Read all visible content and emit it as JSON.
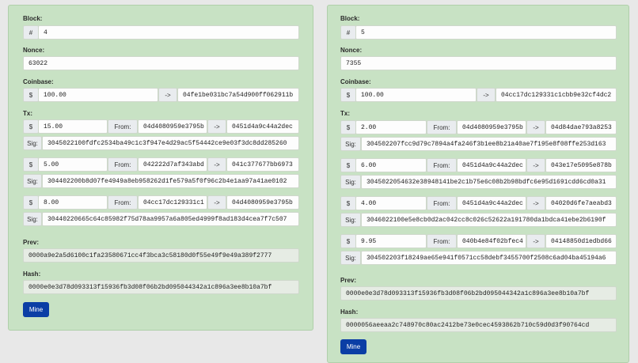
{
  "labels": {
    "block": "Block:",
    "nonce": "Nonce:",
    "coinbase": "Coinbase:",
    "tx": "Tx:",
    "prev": "Prev:",
    "hash": "Hash:",
    "hash_symbol": "#",
    "currency": "$",
    "arrow": "->",
    "from": "From:",
    "sig": "Sig:",
    "mine_button": "Mine"
  },
  "colors": {
    "card_background": "#c8e2c4",
    "mine_button": "#0b3ea5"
  },
  "blocks": [
    {
      "block_number": "4",
      "nonce": "63022",
      "coinbase": {
        "amount": "100.00",
        "to": "04fe1be031bc7a54d900ff062911b"
      },
      "txs": [
        {
          "amount": "15.00",
          "from": "04d4080959e3795b",
          "to": "0451d4a9c44a2dec",
          "sig": "3045022100fdfc2534ba49c1c3f947e4d29ac5f54442ce9e03f3dc8dd285260"
        },
        {
          "amount": "5.00",
          "from": "042222d7af343abd",
          "to": "041c377677bb6973",
          "sig": "304402200b8d07fe4949a8eb958262d1fe579a5f0f96c2b4e1aa97a41ae0102"
        },
        {
          "amount": "8.00",
          "from": "04cc17dc129331c1",
          "to": "04d4080959e3795b",
          "sig": "30440220665c64c85982f75d78aa9957a6a805ed4999f8ad183d4cea7f7c507"
        }
      ],
      "prev": "0000a9e2a5d6100c1fa23580671cc4f3bca3c58180d0f55e49f9e49a389f2777",
      "hash": "0000e0e3d78d093313f15936fb3d08f06b2bd095044342a1c896a3ee8b10a7bf"
    },
    {
      "block_number": "5",
      "nonce": "7355",
      "coinbase": {
        "amount": "100.00",
        "to": "04cc17dc129331c1cbb9e32cf4dc2"
      },
      "txs": [
        {
          "amount": "2.00",
          "from": "04d4080959e3795b",
          "to": "04d84dae793a8253",
          "sig": "304502207fcc9d79c7894a4fa246f3b1ee8b21a40ae7f195e8f08ffe253d163"
        },
        {
          "amount": "6.00",
          "from": "0451d4a9c44a2dec",
          "to": "043e17e5095e878b",
          "sig": "3045022054632e38948141be2c1b75e6c08b2b98bdfc6e95d1691cdd6cd0a31"
        },
        {
          "amount": "4.00",
          "from": "0451d4a9c44a2dec",
          "to": "04020d6fe7aeabd3",
          "sig": "3046022100e5e8cb0d2ac042cc8c026c52622a191780da1bdca41ebe2b6190f"
        },
        {
          "amount": "9.95",
          "from": "040b4e84f02bfec4",
          "to": "04148850d1edbd66",
          "sig": "304502203f18249ae65e941f0571cc58debf3455700f2508c6ad04ba45194a6"
        }
      ],
      "prev": "0000e0e3d78d093313f15936fb3d08f06b2bd095044342a1c896a3ee8b10a7bf",
      "hash": "0000056aeeaa2c748970c80ac2412be73e0cec4593862b710c59d0d3f90764cd"
    }
  ]
}
